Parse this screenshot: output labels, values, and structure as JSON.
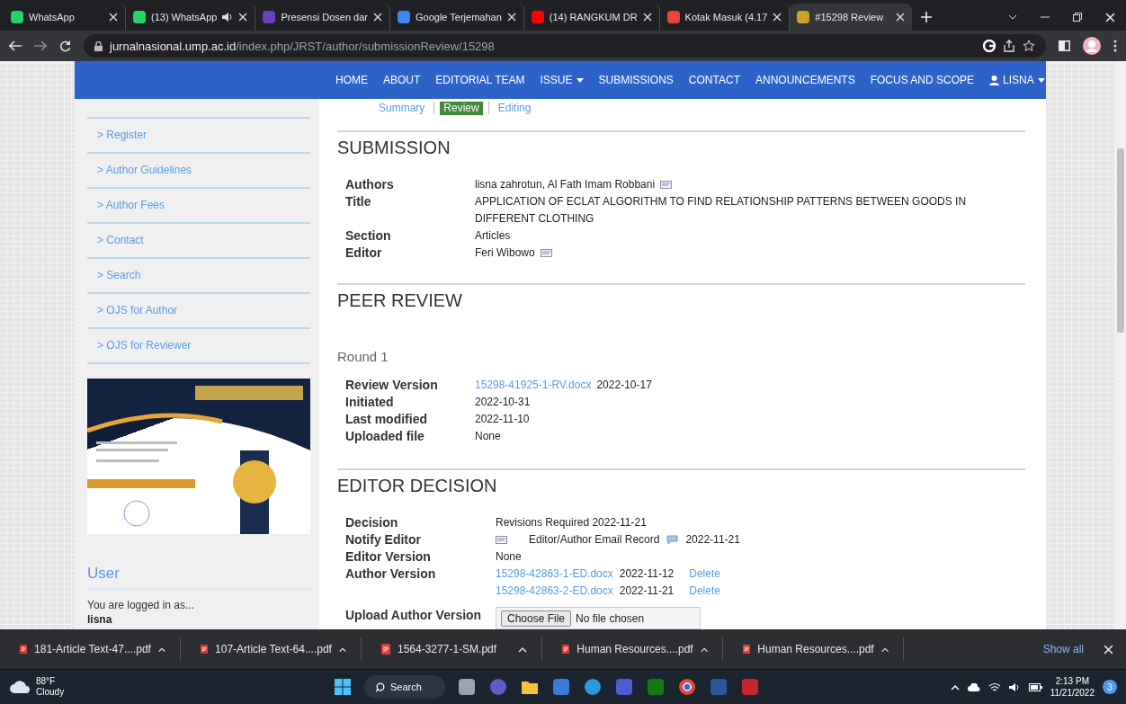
{
  "browser": {
    "tabs": [
      {
        "title": "WhatsApp",
        "color": "#25d366",
        "audio": false,
        "selected": false
      },
      {
        "title": "(13) WhatsApp",
        "color": "#25d366",
        "audio": true,
        "selected": false
      },
      {
        "title": "Presensi Dosen dar",
        "color": "#6a3fc1",
        "audio": false,
        "selected": false
      },
      {
        "title": "Google Terjemahan",
        "color": "#4285f4",
        "audio": false,
        "selected": false
      },
      {
        "title": "(14) RANGKUM DR",
        "color": "#ff0000",
        "audio": false,
        "selected": false
      },
      {
        "title": "Kotak Masuk (4.17",
        "color": "#ea4335",
        "audio": false,
        "selected": false
      },
      {
        "title": "#15298 Review",
        "color": "#c9a227",
        "audio": false,
        "selected": true
      }
    ],
    "address": {
      "domain": "jurnalnasional.ump.ac.id",
      "path": "/index.php/JRST/author/submissionReview/15298"
    }
  },
  "navbar": {
    "items": [
      {
        "label": "HOME",
        "kind": "link"
      },
      {
        "label": "ABOUT",
        "kind": "link"
      },
      {
        "label": "EDITORIAL TEAM",
        "kind": "link"
      },
      {
        "label": "ISSUE",
        "kind": "dropdown"
      },
      {
        "label": "SUBMISSIONS",
        "kind": "link"
      },
      {
        "label": "CONTACT",
        "kind": "link"
      },
      {
        "label": "ANNOUNCEMENTS",
        "kind": "link"
      },
      {
        "label": "FOCUS AND SCOPE",
        "kind": "link"
      },
      {
        "label": "LISNA",
        "kind": "user"
      }
    ]
  },
  "sidebar": {
    "links": [
      "> Register",
      "> Author Guidelines",
      "> Author Fees",
      "> Contact",
      "> Search",
      "> OJS for Author",
      "> OJS for Reviewer"
    ],
    "user": {
      "heading": "User",
      "text": "You are logged in as...",
      "username": "lisna"
    }
  },
  "subtabs": [
    {
      "label": "Summary",
      "selected": false
    },
    {
      "label": "Review",
      "selected": true
    },
    {
      "label": "Editing",
      "selected": false
    }
  ],
  "submission": {
    "heading": "SUBMISSION",
    "rows": [
      {
        "label": "Authors",
        "value": "lisna zahrotun, Al Fath Imam Robbani",
        "email": true
      },
      {
        "label": "Title",
        "value": "APPLICATION OF ECLAT ALGORITHM TO FIND RELATIONSHIP PATTERNS BETWEEN GOODS IN DIFFERENT CLOTHING",
        "email": false
      },
      {
        "label": "Section",
        "value": "Articles",
        "email": false
      },
      {
        "label": "Editor",
        "value": "Feri Wibowo",
        "email": true
      }
    ]
  },
  "peer_review": {
    "heading": "PEER REVIEW",
    "round": "Round 1",
    "rows": [
      {
        "label": "Review Version",
        "link": "15298-41925-1-RV.docx",
        "value": "2022-10-17"
      },
      {
        "label": "Initiated",
        "value": "2022-10-31"
      },
      {
        "label": "Last modified",
        "value": "2022-11-10"
      },
      {
        "label": "Uploaded file",
        "value": "None"
      }
    ]
  },
  "editor_decision": {
    "heading": "EDITOR DECISION",
    "decision": {
      "label": "Decision",
      "value": "Revisions Required 2022-11-21"
    },
    "notify": {
      "label": "Notify Editor",
      "record": "Editor/Author Email Record",
      "date": "2022-11-21"
    },
    "editor_version": {
      "label": "Editor Version",
      "value": "None"
    },
    "author_version": {
      "label": "Author Version",
      "files": [
        {
          "file": "15298-42863-1-ED.docx",
          "date": "2022-11-12",
          "action": "Delete"
        },
        {
          "file": "15298-42863-2-ED.docx",
          "date": "2022-11-21",
          "action": "Delete"
        }
      ]
    },
    "upload": {
      "label": "Upload Author Version",
      "button": "Choose File",
      "status": "No file chosen"
    }
  },
  "downloads": {
    "items": [
      "181-Article Text-47....pdf",
      "107-Article Text-64....pdf",
      "1564-3277-1-SM.pdf",
      "Human Resources....pdf",
      "Human Resources....pdf"
    ],
    "show_all": "Show all"
  },
  "taskbar": {
    "weather": {
      "temp": "88°F",
      "condition": "Cloudy"
    },
    "search": "Search",
    "time": "2:13 PM",
    "date": "11/21/2022",
    "notifications": "3"
  }
}
